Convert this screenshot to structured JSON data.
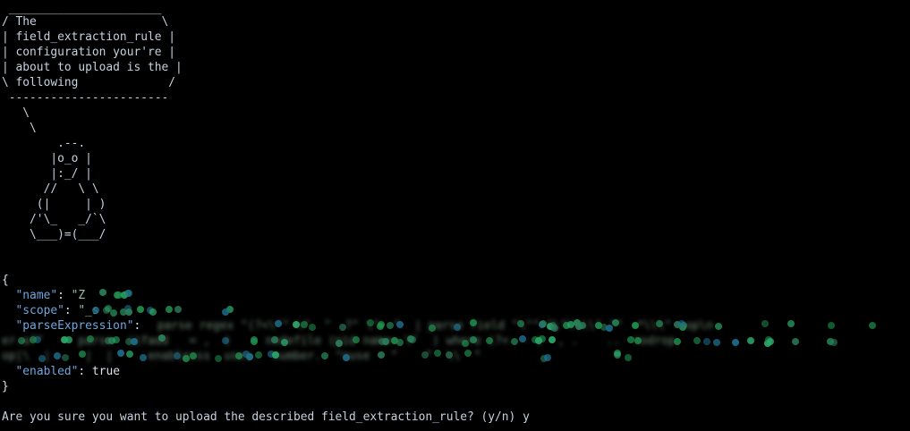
{
  "cowsay": {
    "bubble": [
      " ______________________",
      "/ The                  \\",
      "| field_extraction_rule |",
      "| configuration your're |",
      "| about to upload is the |",
      "\\ following             /",
      " -----------------------"
    ],
    "tux": [
      "   \\",
      "    \\",
      "        .--.",
      "       |o_o |",
      "       |:_/ |",
      "      //   \\ \\",
      "     (|     | )",
      "    /'\\_   _/`\\",
      "    \\___)=(___/"
    ]
  },
  "json_block": {
    "open_brace": "{",
    "close_brace": "}",
    "name_key": "\"name\"",
    "name_value_visible": "\"Z",
    "scope_key": "\"scope\"",
    "scope_value_visible": "\"_s",
    "parse_key": "\"parseExpression\"",
    "parse_fragment_1": "parse regex \"(?<\\\"\" \\\"  \"  ?\" \\\"  \"  | parse field \"\\\"\" \"\\\"\\\\\\\\\" \"\"  *\\\\\\\"  op\\n",
    "parse_fragment_2": "er.a?\"   = parse  (ifadd   = ,  )     nodefile (pid name= \\\"  ) where (?<  - )  , .    ..  nodrop",
    "parse_fragment_3": "op|\\  |     |  |     enablesss  user.  number.  \"nuse   \"    \"  \\\\  \"",
    "enabled_key": "\"enabled\"",
    "enabled_value": "true"
  },
  "prompt": {
    "question": "Are you sure you want to upload the described field_extraction_rule? (y/n) ",
    "answer": "y"
  },
  "colors": {
    "background": "#000000",
    "foreground": "#c5d1de",
    "json_key": "#6fa6dc",
    "redaction_dots": [
      "#1f8f4e",
      "#2aa86a",
      "#1d6f8c",
      "#2c7d5a"
    ]
  }
}
